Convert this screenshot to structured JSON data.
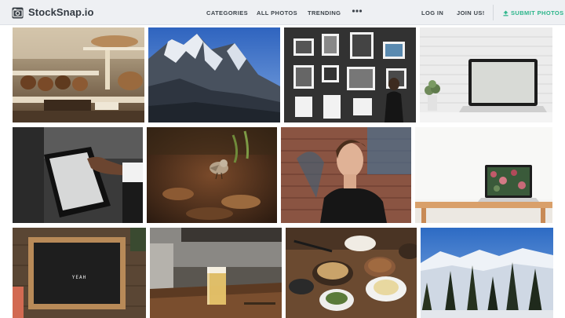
{
  "brand": {
    "name": "StockSnap.io",
    "logo_icon": "camera-icon"
  },
  "nav": {
    "categories": "CATEGORIES",
    "all_photos": "ALL PHOTOS",
    "trending": "TRENDING",
    "more_icon": "more-dots-icon",
    "login": "LOG IN",
    "join": "JOIN US!",
    "submit": "SUBMIT PHOTOS",
    "submit_icon": "upload-icon"
  },
  "colors": {
    "header_bg": "#eef0f3",
    "accent": "#2bb58a",
    "nav_text": "#3c434a",
    "brand_text": "#333a42"
  },
  "photos": [
    {
      "subject": "bakery-counter"
    },
    {
      "subject": "snowy-mountain"
    },
    {
      "subject": "art-gallery"
    },
    {
      "subject": "laptop-brick-wall"
    },
    {
      "subject": "payment-terminal"
    },
    {
      "subject": "bird-on-soil"
    },
    {
      "subject": "man-leather-jacket"
    },
    {
      "subject": "laptop-on-desk"
    },
    {
      "subject": "letter-board",
      "caption": "YEAH"
    },
    {
      "subject": "beer-on-bar"
    },
    {
      "subject": "korean-dishes"
    },
    {
      "subject": "snowy-pine-trees"
    }
  ]
}
